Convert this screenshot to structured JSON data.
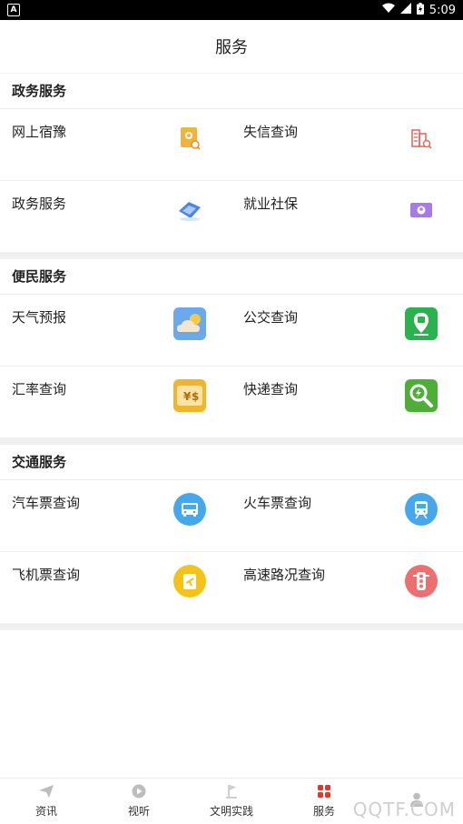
{
  "status": {
    "time": "5:09",
    "app_badge": "A"
  },
  "header": {
    "title": "服务"
  },
  "sections": [
    {
      "title": "政务服务",
      "items": [
        {
          "label": "网上宿豫",
          "icon": "document-gear-icon"
        },
        {
          "label": "失信查询",
          "icon": "building-search-icon"
        },
        {
          "label": "政务服务",
          "icon": "service-card-icon"
        },
        {
          "label": "就业社保",
          "icon": "id-card-icon"
        }
      ]
    },
    {
      "title": "便民服务",
      "items": [
        {
          "label": "天气预报",
          "icon": "weather-cloud-icon"
        },
        {
          "label": "公交查询",
          "icon": "bus-stop-icon"
        },
        {
          "label": "汇率查询",
          "icon": "currency-icon"
        },
        {
          "label": "快递查询",
          "icon": "express-search-icon"
        }
      ]
    },
    {
      "title": "交通服务",
      "items": [
        {
          "label": "汽车票查询",
          "icon": "bus-icon"
        },
        {
          "label": "火车票查询",
          "icon": "train-icon"
        },
        {
          "label": "飞机票查询",
          "icon": "plane-ticket-icon"
        },
        {
          "label": "高速路况查询",
          "icon": "traffic-light-icon"
        }
      ]
    }
  ],
  "tabs": [
    {
      "label": "资讯",
      "icon": "paper-plane-icon"
    },
    {
      "label": "视听",
      "icon": "play-icon"
    },
    {
      "label": "文明实践",
      "icon": "flag-icon"
    },
    {
      "label": "服务",
      "icon": "grid-icon",
      "active": true
    },
    {
      "label": "",
      "icon": "person-icon"
    }
  ],
  "watermark": "QQTF.COM",
  "colors": {
    "active_tab": "#e0392b",
    "section_gap": "#f0f0f0"
  }
}
